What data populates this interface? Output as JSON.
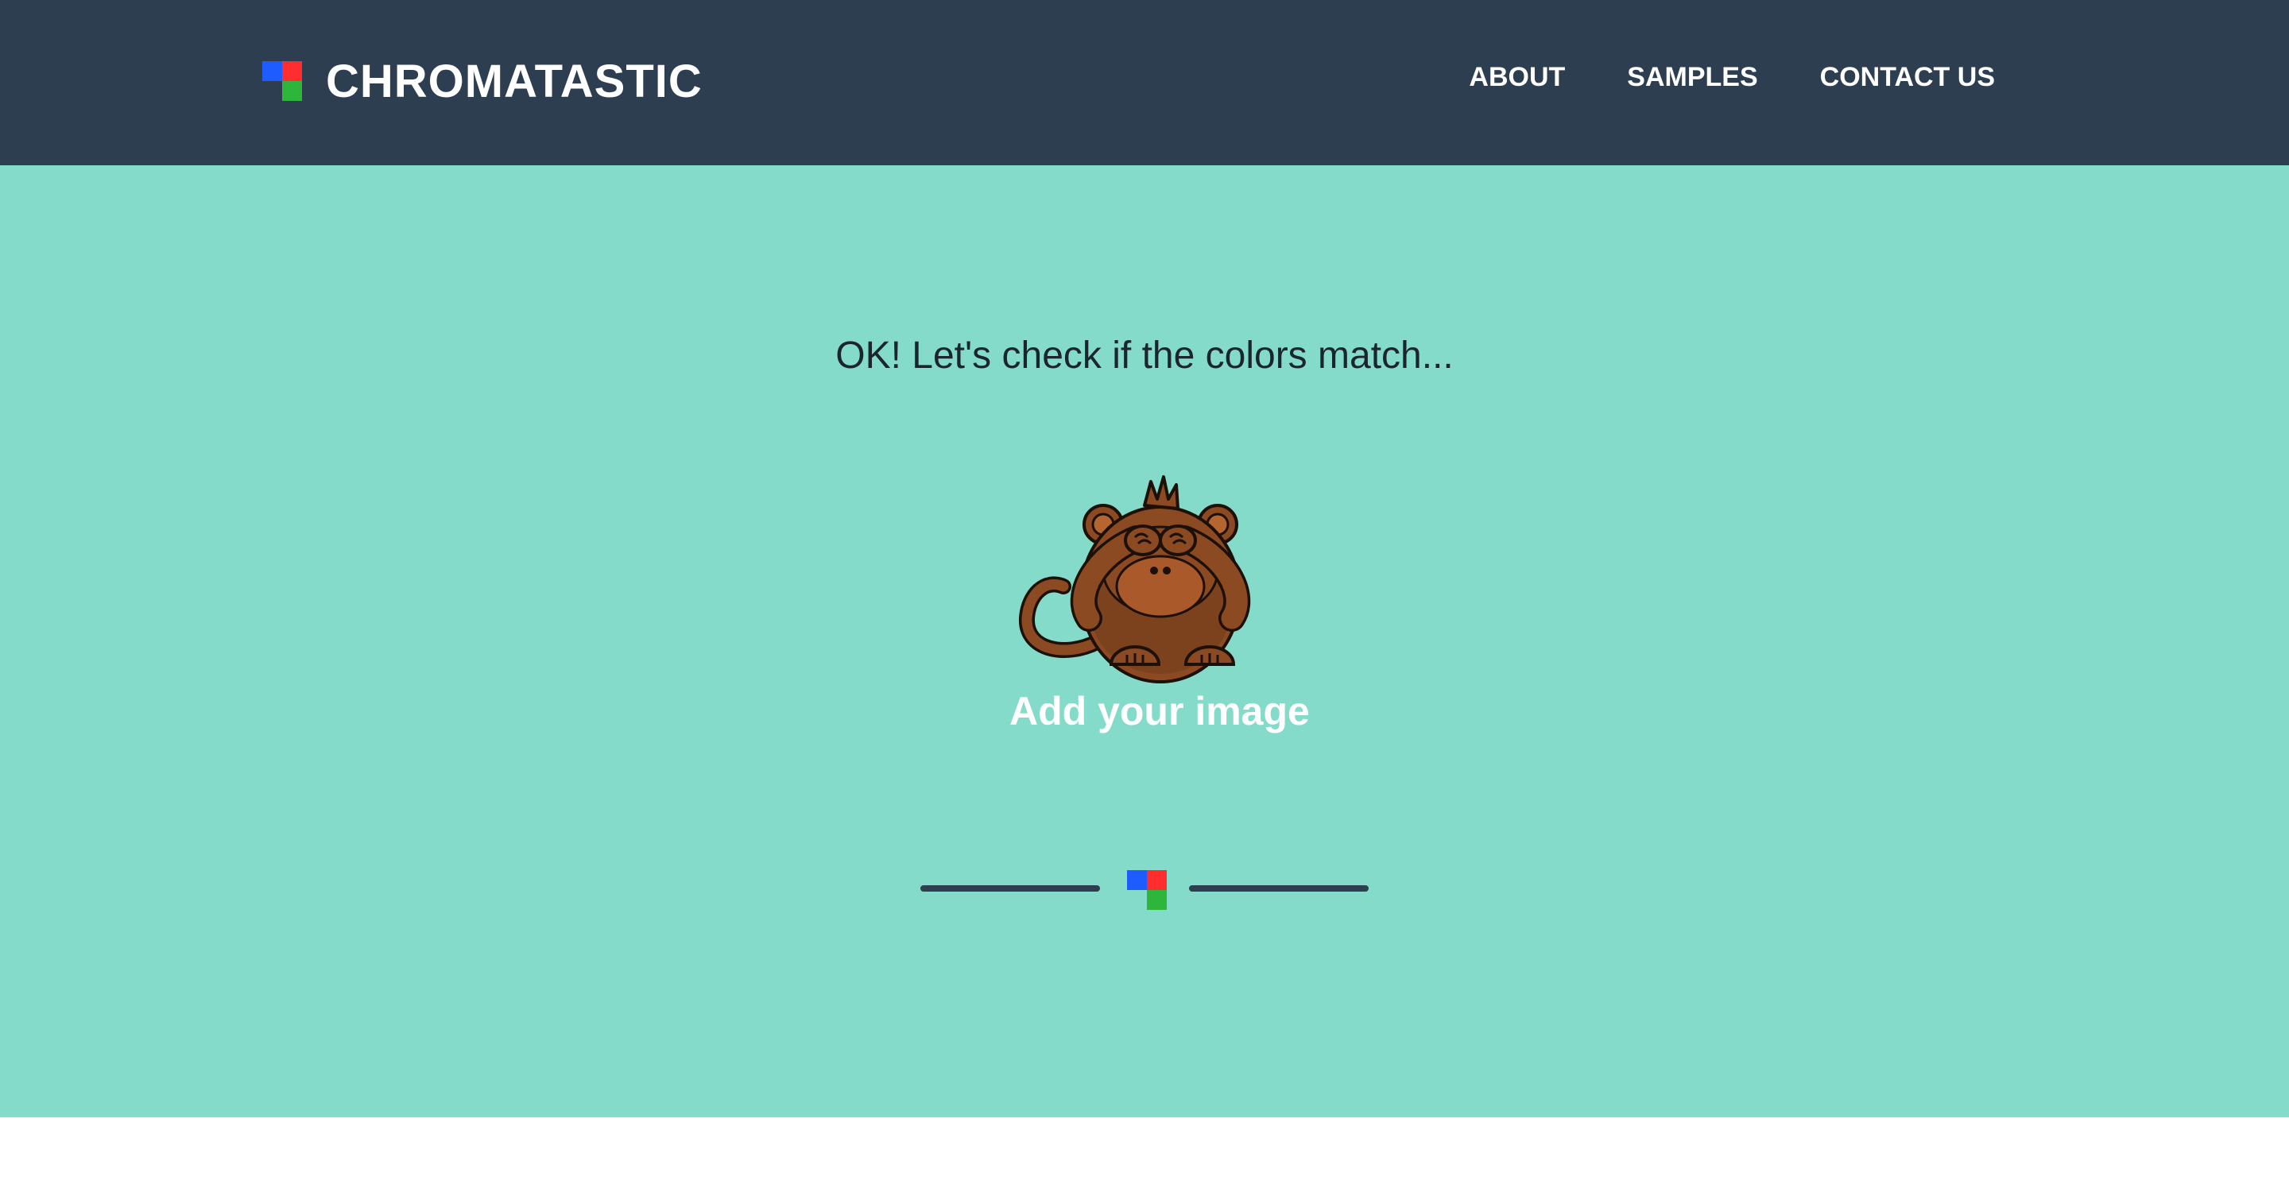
{
  "brand": {
    "name": "CHROMATASTIC",
    "logo_colors": {
      "blue": "#1f5cff",
      "red": "#ff2d2d",
      "green": "#2db53c"
    }
  },
  "nav": {
    "items": [
      {
        "label": "ABOUT"
      },
      {
        "label": "SAMPLES"
      },
      {
        "label": "CONTACT US"
      }
    ]
  },
  "hero": {
    "headline": "OK! Let's check if the colors match...",
    "upload_label": "Add your image",
    "illustration": "see-no-evil-monkey-icon"
  },
  "colors": {
    "navbar": "#2c3e50",
    "hero_bg": "#85dbc9",
    "footer_bg": "#ffffff"
  }
}
